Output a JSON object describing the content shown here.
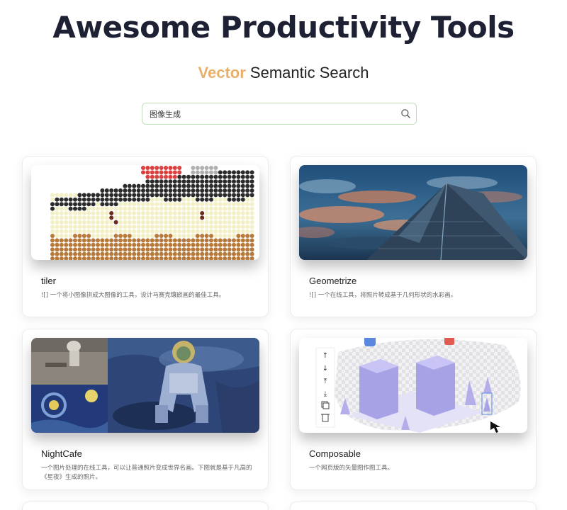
{
  "header": {
    "title": "Awesome Productivity Tools",
    "subtitle_accent": "Vector",
    "subtitle_rest": " Semantic Search"
  },
  "search": {
    "value": "图像生成",
    "icon": "search-icon"
  },
  "colors": {
    "accent": "#e8b06a",
    "title": "#1d2133",
    "search_border": "#bfe0b6"
  },
  "tools": [
    {
      "name": "tiler",
      "description": "![] 一个将小图像拼成大图像的工具，设计马赛克镶嵌画的最佳工具。"
    },
    {
      "name": "Geometrize",
      "description": "![] 一个在线工具，将照片转成基于几何形状的水彩画。"
    },
    {
      "name": "NightCafe",
      "description": "一个图片处理的在线工具，可以让普通照片变成世界名画。下图就是基于凡高的《星夜》生成的照片。"
    },
    {
      "name": "Composable",
      "description": "一个网页版的矢量图作图工具。"
    }
  ]
}
